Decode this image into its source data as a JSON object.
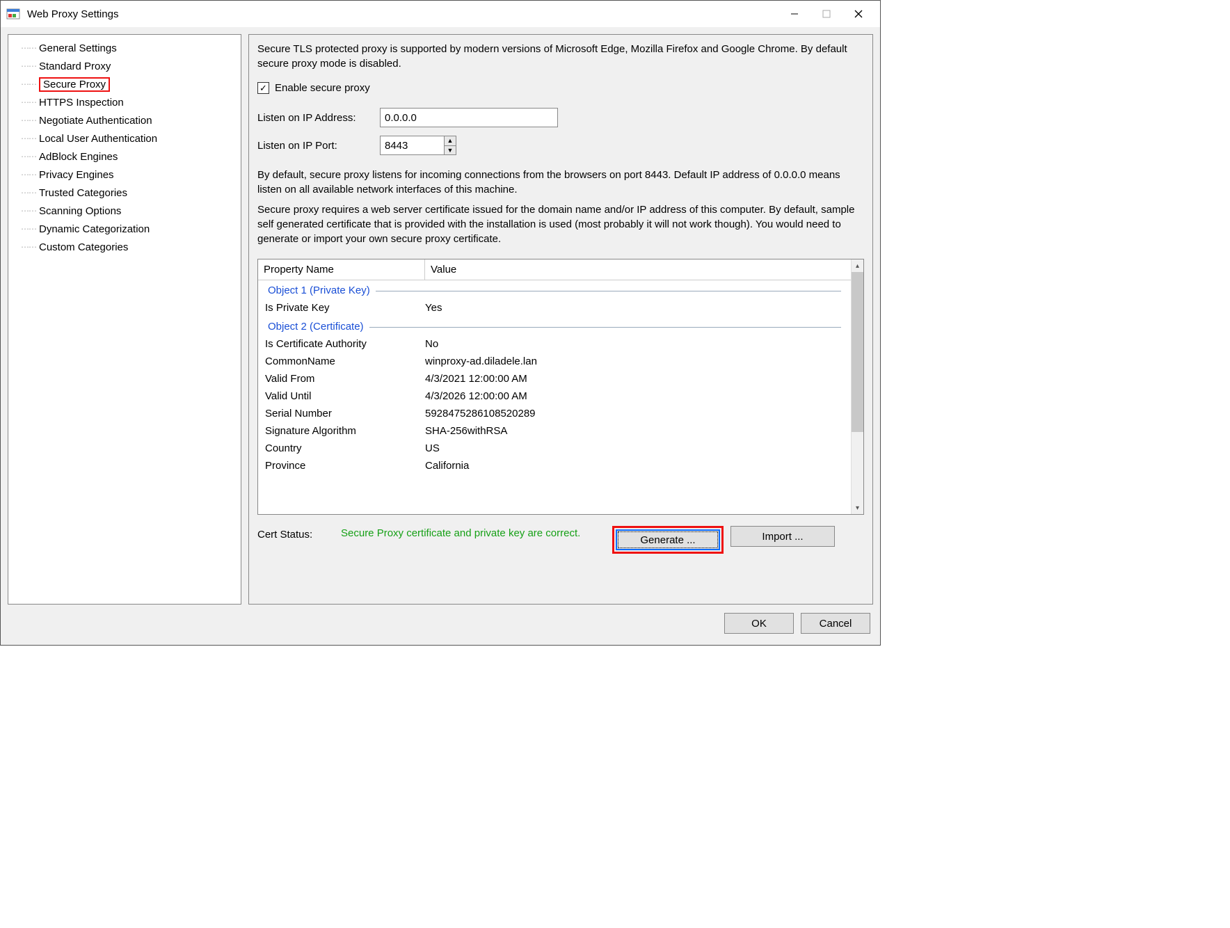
{
  "window": {
    "title": "Web Proxy Settings"
  },
  "sidebar": {
    "items": [
      "General Settings",
      "Standard Proxy",
      "Secure Proxy",
      "HTTPS Inspection",
      "Negotiate Authentication",
      "Local User Authentication",
      "AdBlock Engines",
      "Privacy Engines",
      "Trusted Categories",
      "Scanning Options",
      "Dynamic Categorization",
      "Custom Categories"
    ],
    "selected_index": 2
  },
  "main": {
    "intro": "Secure TLS protected proxy is supported by modern versions of Microsoft Edge, Mozilla Firefox and Google Chrome. By default secure proxy mode is disabled.",
    "enable_label": "Enable secure proxy",
    "enable_checked": true,
    "ip_label": "Listen on IP Address:",
    "ip_value": "0.0.0.0",
    "port_label": "Listen on IP Port:",
    "port_value": "8443",
    "note1": "By default, secure proxy listens for incoming connections from the browsers on port 8443. Default IP address of 0.0.0.0 means listen on all available network interfaces of this machine.",
    "note2": "Secure proxy requires a web server certificate issued for the domain name and/or IP address of this computer. By default, sample self generated certificate that is provided with the installation is used (most probably it will not work though). You would need to generate or import your own secure proxy certificate."
  },
  "props": {
    "col1": "Property Name",
    "col2": "Value",
    "group1": "Object 1 (Private Key)",
    "rows1": [
      {
        "name": "Is Private Key",
        "value": "Yes"
      }
    ],
    "group2": "Object 2 (Certificate)",
    "rows2": [
      {
        "name": "Is Certificate Authority",
        "value": "No"
      },
      {
        "name": "CommonName",
        "value": "winproxy-ad.diladele.lan"
      },
      {
        "name": "Valid From",
        "value": "4/3/2021 12:00:00 AM"
      },
      {
        "name": "Valid Until",
        "value": "4/3/2026 12:00:00 AM"
      },
      {
        "name": "Serial Number",
        "value": "5928475286108520289"
      },
      {
        "name": "Signature Algorithm",
        "value": "SHA-256withRSA"
      },
      {
        "name": "Country",
        "value": "US"
      },
      {
        "name": "Province",
        "value": "California"
      }
    ]
  },
  "cert": {
    "label": "Cert Status:",
    "message": "Secure Proxy certificate and private key are correct.",
    "generate": "Generate ...",
    "import": "Import ..."
  },
  "footer": {
    "ok": "OK",
    "cancel": "Cancel"
  }
}
